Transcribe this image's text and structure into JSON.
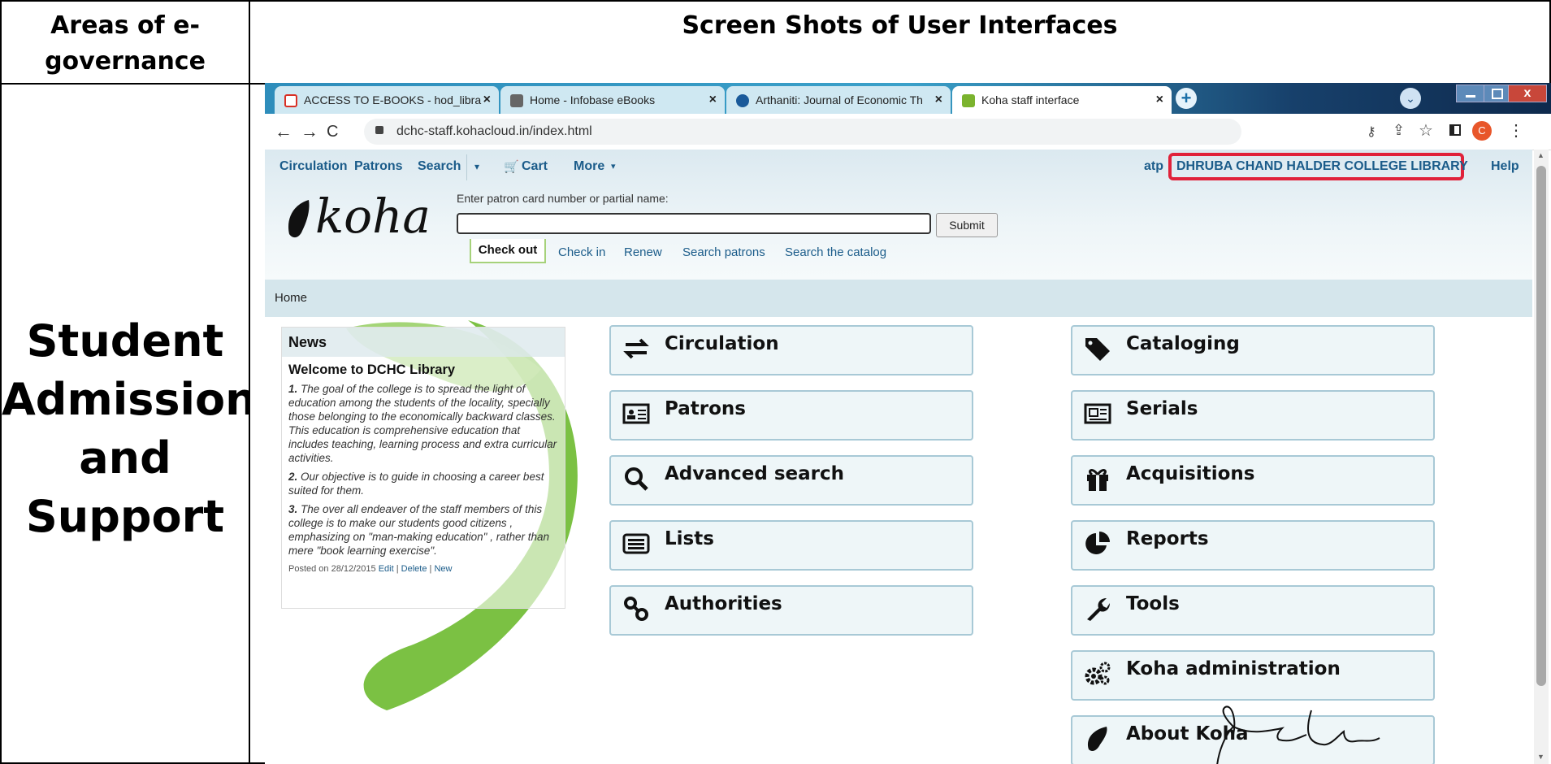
{
  "table": {
    "col1_header": "Areas of e-governance",
    "col2_header": "Screen Shots of User Interfaces",
    "area_lines": [
      "Student",
      "Admission",
      "and",
      "Support"
    ]
  },
  "browser": {
    "tabs": [
      {
        "label": "ACCESS TO E-BOOKS - hod_libra",
        "icon": "gmail-icon",
        "color": "#d93025"
      },
      {
        "label": "Home - Infobase eBooks",
        "icon": "infobase-icon",
        "color": "#555"
      },
      {
        "label": "Arthaniti: Journal of Economic Th",
        "icon": "journal-icon",
        "color": "#1a5a9a"
      },
      {
        "label": "Koha staff interface",
        "icon": "koha-icon",
        "color": "#7bb32e"
      }
    ],
    "url": "dchc-staff.kohacloud.in/index.html",
    "profile_initial": "C"
  },
  "koha": {
    "menu": [
      "Circulation",
      "Patrons",
      "Search",
      "Cart",
      "More"
    ],
    "user": "atp",
    "library": "DHRUBA CHAND HALDER COLLEGE LIBRARY",
    "help": "Help",
    "logo_text": "koha",
    "search_label": "Enter patron card number or partial name:",
    "search_value": "",
    "submit": "Submit",
    "search_tabs": [
      "Check out",
      "Check in",
      "Renew",
      "Search patrons",
      "Search the catalog"
    ],
    "breadcrumb": "Home",
    "news": {
      "title": "News",
      "heading": "Welcome to DCHC Library",
      "items": [
        {
          "num": "1.",
          "text": "The goal of the college is to spread the light of education among the students of the locality, specially those belonging to the economically backward classes. This education is comprehensive education that includes teaching, learning process and extra curricular activities."
        },
        {
          "num": "2.",
          "text": "Our objective is to guide in choosing a career best suited for them."
        },
        {
          "num": "3.",
          "text": "The over all endeaver of the staff members of this college is to make our students good citizens , emphasizing on \"man-making education\" , rather than mere \"book learning exercise\"."
        }
      ],
      "posted": "Posted on 28/12/2015",
      "edit": "Edit",
      "delete": "Delete",
      "new": "New"
    },
    "modules_left": [
      "Circulation",
      "Patrons",
      "Advanced search",
      "Lists",
      "Authorities"
    ],
    "modules_right": [
      "Cataloging",
      "Serials",
      "Acquisitions",
      "Reports",
      "Tools",
      "Koha administration",
      "About Koha"
    ]
  },
  "colors": {
    "koha_link": "#1b5c8a",
    "highlight_box": "#e0223a",
    "koha_green": "#7bc143"
  }
}
